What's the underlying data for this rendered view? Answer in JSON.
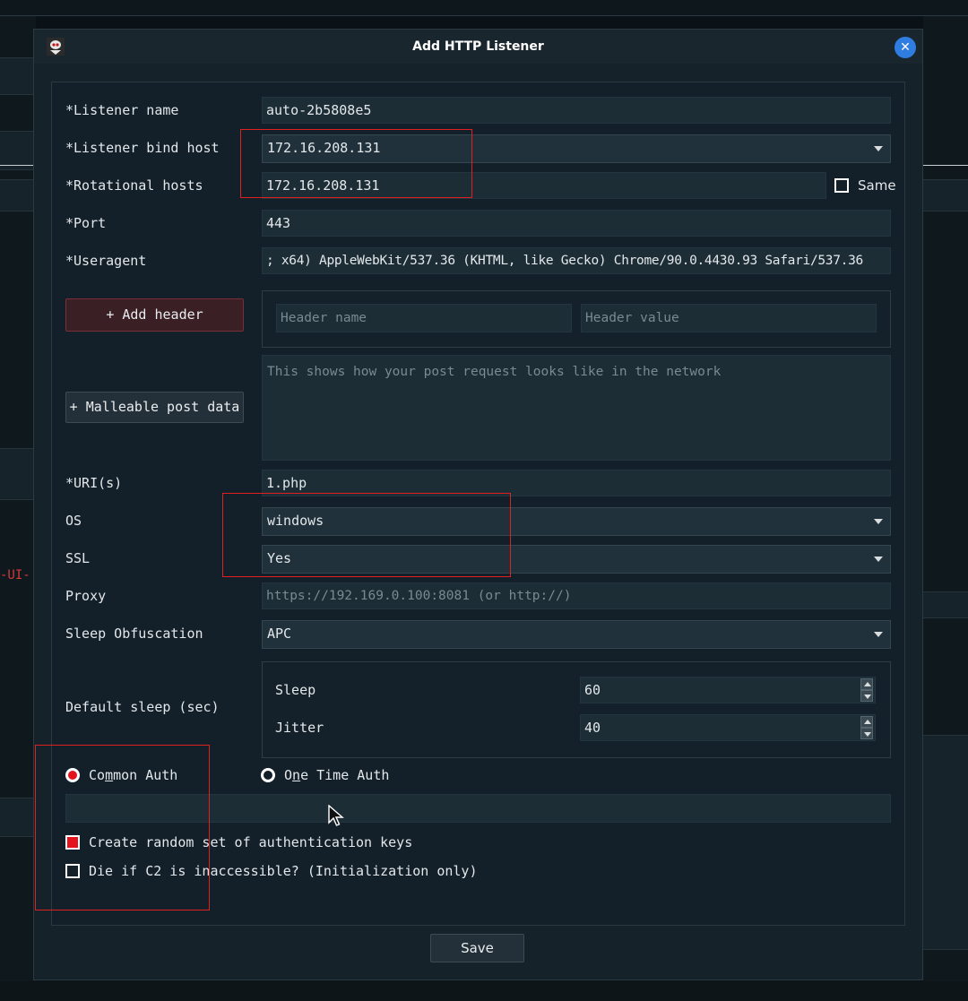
{
  "dialog": {
    "title": "Add HTTP Listener",
    "close_glyph": "✕"
  },
  "background": {
    "stray_text": "-UI-"
  },
  "form": {
    "listener_name": {
      "label": "*Listener name",
      "value": "auto-2b5808e5"
    },
    "bind_host": {
      "label": "*Listener bind host",
      "value": "172.16.208.131"
    },
    "rotational_hosts": {
      "label": "*Rotational hosts",
      "value": "172.16.208.131",
      "same_label": "Same",
      "same_checked": false
    },
    "port": {
      "label": "*Port",
      "value": "443"
    },
    "useragent": {
      "label": "*Useragent",
      "value": "; x64) AppleWebKit/537.36 (KHTML, like Gecko) Chrome/90.0.4430.93 Safari/537.36"
    },
    "add_header": {
      "button": "+ Add header",
      "name_placeholder": "Header name",
      "value_placeholder": "Header value"
    },
    "malleable": {
      "button": "+ Malleable post data",
      "placeholder": "This shows how your post request looks like in the network"
    },
    "uris": {
      "label": "*URI(s)",
      "value": "1.php"
    },
    "os": {
      "label": "OS",
      "value": "windows"
    },
    "ssl": {
      "label": "SSL",
      "value": "Yes"
    },
    "proxy": {
      "label": "Proxy",
      "placeholder": "https://192.169.0.100:8081 (or http://)"
    },
    "sleep_obfuscation": {
      "label": "Sleep Obfuscation",
      "value": "APC"
    },
    "default_sleep": {
      "label": "Default sleep (sec)",
      "sleep_label": "Sleep",
      "sleep_value": "60",
      "jitter_label": "Jitter",
      "jitter_value": "40"
    },
    "auth": {
      "common_prefix": "Co",
      "common_underline": "m",
      "common_suffix": "mon Auth",
      "one_time_prefix": "O",
      "one_time_underline": "n",
      "one_time_suffix": "e Time Auth",
      "selected": "common"
    },
    "random_keys": {
      "label": "Create random set of authentication keys",
      "checked": true
    },
    "die_if_inaccessible": {
      "label": "Die if C2 is inaccessible? (Initialization only)",
      "checked": false
    },
    "save_button": "Save"
  },
  "colors": {
    "accent_red": "#e3141e",
    "close_blue": "#2f7de1",
    "annotation": "#e02020"
  }
}
